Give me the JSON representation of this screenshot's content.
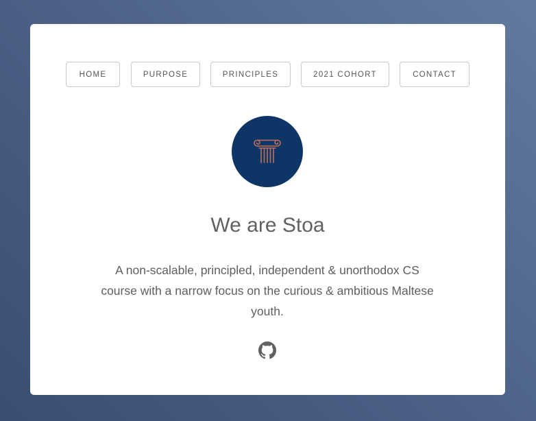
{
  "nav": {
    "items": [
      {
        "label": "HOME"
      },
      {
        "label": "PURPOSE"
      },
      {
        "label": "PRINCIPLES"
      },
      {
        "label": "2021 COHORT"
      },
      {
        "label": "CONTACT"
      }
    ]
  },
  "hero": {
    "logo_icon": "ionic-column-icon",
    "title": "We are Stoa",
    "description": "A non-scalable, principled, independent & unorthodox CS course with a narrow focus on the curious & ambitious Maltese youth."
  },
  "footer": {
    "github_icon": "github-icon"
  },
  "colors": {
    "background_start": "#3a4e72",
    "background_end": "#627aa0",
    "logo_circle": "#0d3566",
    "logo_accent": "#c0705a",
    "text": "#616161"
  }
}
